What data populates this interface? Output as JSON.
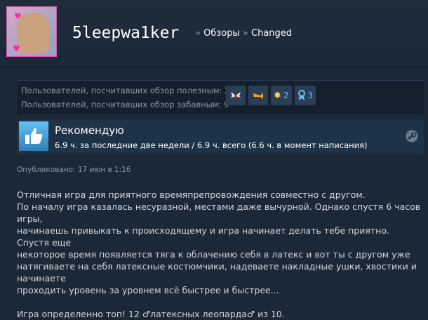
{
  "header": {
    "username": "5leepwa1ker",
    "breadcrumb_sep": "»",
    "crumbs": [
      "Обзоры",
      "Changed"
    ]
  },
  "stats": {
    "helpful": "Пользователей, посчитавших обзор полезным: 27",
    "funny": "Пользователей, посчитавших обзор забавным: 9",
    "awards": [
      {
        "icon": "wings-icon",
        "count": ""
      },
      {
        "icon": "horn-icon",
        "count": ""
      },
      {
        "icon": "sun-icon",
        "count": "2"
      },
      {
        "icon": "ribbon-icon",
        "count": "3"
      }
    ]
  },
  "recommendation": {
    "title": "Рекомендую",
    "hours": "6.9 ч. за последние две недели / 6.9 ч. всего (6.6 ч. в момент написания)"
  },
  "posted": "Опубликовано: 17 июн в 1:16",
  "review": {
    "lines": [
      "Отличная игра для приятного времяпрепровождения совместно с другом.",
      "По началу игра казалась несуразной, местами даже вычурной. Однако спустя 6 часов игры,",
      "начинаешь привыкать к происходящему и игра начинает делать тебе приятно. Спустя еще",
      "некоторое время появляется тяга к облачению себя в латекс и вот ты с другом уже",
      "натягиваете на себя латексные костюмчики, надеваете накладные ушки, хвостики и начинаете",
      "проходить уровень за уровнем всё быстрее и быстрее..."
    ],
    "closing": "Игра определенно топ! 12 ♂латексных леопарда♂ из 10."
  },
  "colors": {
    "background": "#1b2838",
    "accent": "#66c0f4",
    "panel": "#16202d",
    "rec_panel": "#1e3347"
  }
}
